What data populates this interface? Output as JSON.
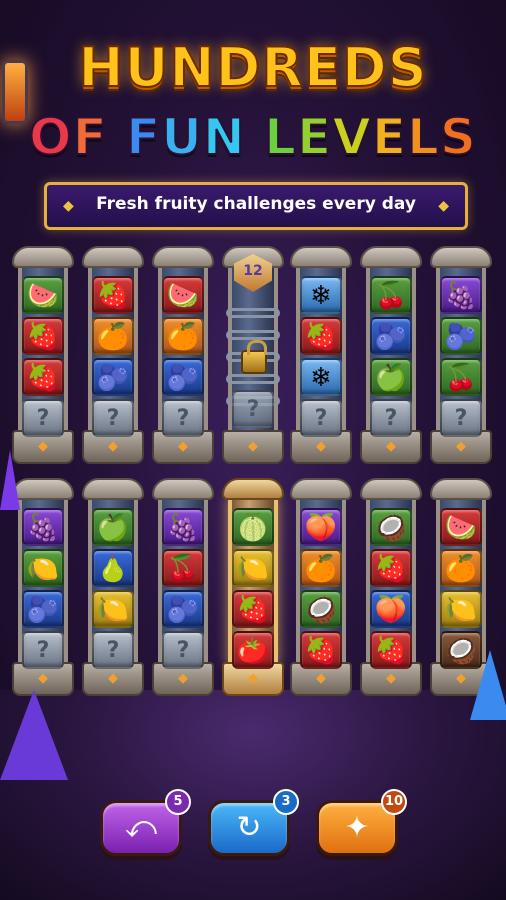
{
  "title": {
    "line1": "HUNDREDS",
    "line2": [
      {
        "text": "O",
        "color": "#e8384a"
      },
      {
        "text": "F ",
        "color": "#f06a3a"
      },
      {
        "text": "F",
        "color": "#3a8af0"
      },
      {
        "text": "U",
        "color": "#3ab0f0"
      },
      {
        "text": "N ",
        "color": "#34c8f0"
      },
      {
        "text": "L",
        "color": "#6ad040"
      },
      {
        "text": "E",
        "color": "#90d030"
      },
      {
        "text": "V",
        "color": "#c8d020"
      },
      {
        "text": "E",
        "color": "#f0b020"
      },
      {
        "text": "L",
        "color": "#f09020"
      },
      {
        "text": "S",
        "color": "#f07020"
      }
    ]
  },
  "banner": {
    "text": "Fresh fruity challenges every day"
  },
  "rows": [
    [
      {
        "tiles": [
          {
            "icon": "🍉",
            "bg": "green"
          },
          {
            "icon": "🍓",
            "bg": "red"
          },
          {
            "icon": "🍓",
            "bg": "red"
          },
          {
            "icon": "?",
            "bg": "mystery"
          }
        ]
      },
      {
        "tiles": [
          {
            "icon": "🍓",
            "bg": "red"
          },
          {
            "icon": "🍊",
            "bg": "orange"
          },
          {
            "icon": "🫐",
            "bg": "blue"
          },
          {
            "icon": "?",
            "bg": "mystery"
          }
        ]
      },
      {
        "tiles": [
          {
            "icon": "🍉",
            "bg": "red"
          },
          {
            "icon": "🍊",
            "bg": "orange"
          },
          {
            "icon": "🫐",
            "bg": "blue"
          },
          {
            "icon": "?",
            "bg": "mystery"
          }
        ]
      },
      {
        "locked": true,
        "level": "12",
        "tiles": [
          {
            "icon": "?",
            "bg": "mystery"
          }
        ]
      },
      {
        "tiles": [
          {
            "icon": "❄",
            "bg": "ice"
          },
          {
            "icon": "🍓",
            "bg": "red"
          },
          {
            "icon": "❄",
            "bg": "ice"
          },
          {
            "icon": "?",
            "bg": "mystery"
          }
        ]
      },
      {
        "tiles": [
          {
            "icon": "🍒",
            "bg": "green"
          },
          {
            "icon": "🫐",
            "bg": "blue"
          },
          {
            "icon": "🍏",
            "bg": "green"
          },
          {
            "icon": "?",
            "bg": "mystery"
          }
        ]
      },
      {
        "tiles": [
          {
            "icon": "🍇",
            "bg": "purple"
          },
          {
            "icon": "🫐",
            "bg": "green"
          },
          {
            "icon": "🍒",
            "bg": "green"
          },
          {
            "icon": "?",
            "bg": "mystery"
          }
        ]
      }
    ],
    [
      {
        "tiles": [
          {
            "icon": "🍇",
            "bg": "purple"
          },
          {
            "icon": "🍋",
            "bg": "green"
          },
          {
            "icon": "🫐",
            "bg": "blue"
          },
          {
            "icon": "?",
            "bg": "mystery"
          }
        ]
      },
      {
        "tiles": [
          {
            "icon": "🍏",
            "bg": "green"
          },
          {
            "icon": "🍐",
            "bg": "blue"
          },
          {
            "icon": "🍋",
            "bg": "yellow"
          },
          {
            "icon": "?",
            "bg": "mystery"
          }
        ]
      },
      {
        "tiles": [
          {
            "icon": "🍇",
            "bg": "purple"
          },
          {
            "icon": "🍒",
            "bg": "red"
          },
          {
            "icon": "🫐",
            "bg": "blue"
          },
          {
            "icon": "?",
            "bg": "mystery"
          }
        ]
      },
      {
        "highlight": true,
        "tiles": [
          {
            "icon": "🍈",
            "bg": "green"
          },
          {
            "icon": "🍋",
            "bg": "yellow"
          },
          {
            "icon": "🍓",
            "bg": "red"
          },
          {
            "icon": "🍅",
            "bg": "red"
          }
        ]
      },
      {
        "tiles": [
          {
            "icon": "🍑",
            "bg": "purple"
          },
          {
            "icon": "🍊",
            "bg": "orange"
          },
          {
            "icon": "🥥",
            "bg": "green"
          },
          {
            "icon": "🍓",
            "bg": "red"
          }
        ]
      },
      {
        "tiles": [
          {
            "icon": "🥥",
            "bg": "green"
          },
          {
            "icon": "🍓",
            "bg": "red"
          },
          {
            "icon": "🍑",
            "bg": "blue"
          },
          {
            "icon": "🍓",
            "bg": "red"
          }
        ]
      },
      {
        "tiles": [
          {
            "icon": "🍉",
            "bg": "red"
          },
          {
            "icon": "🍊",
            "bg": "orange"
          },
          {
            "icon": "🍋",
            "bg": "yellow"
          },
          {
            "icon": "🥥",
            "bg": "brown"
          }
        ]
      }
    ]
  ],
  "buttons": [
    {
      "name": "undo-button",
      "icon": "⤺",
      "count": "5",
      "cls": "undo"
    },
    {
      "name": "refresh-button",
      "icon": "↻",
      "count": "3",
      "cls": "refresh"
    },
    {
      "name": "magic-button",
      "icon": "✦",
      "count": "10",
      "cls": "magic"
    }
  ]
}
